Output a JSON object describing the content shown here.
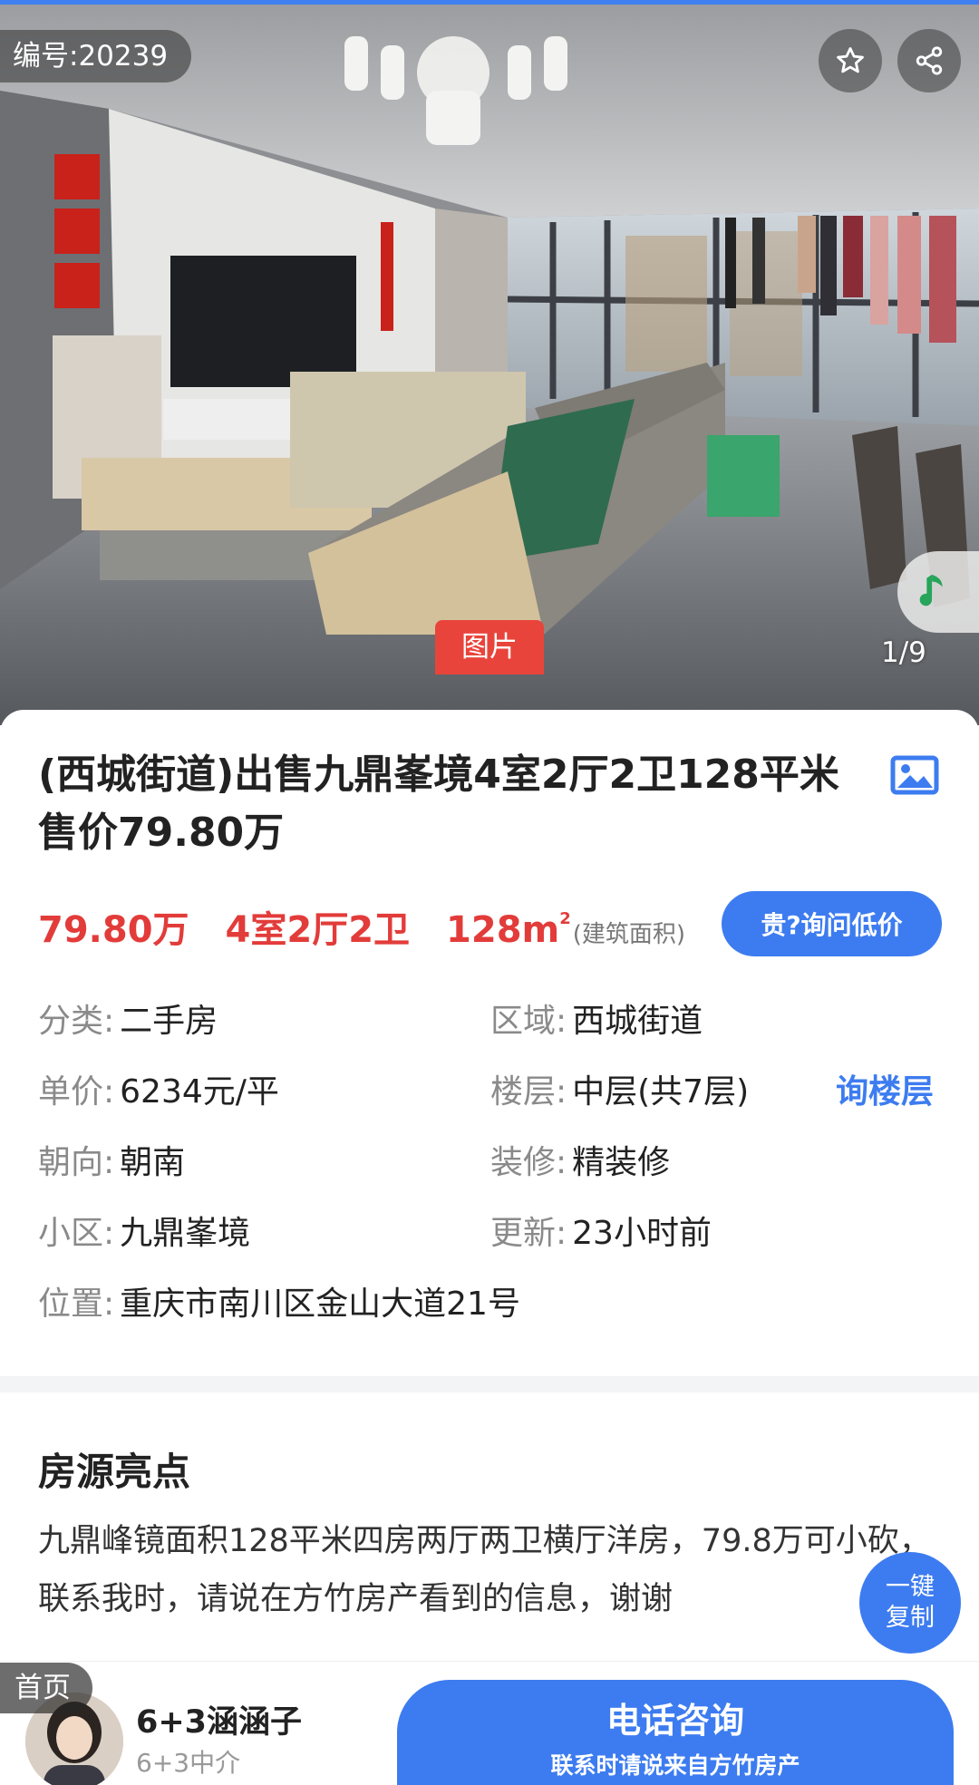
{
  "hero": {
    "code_label": "编号:20239",
    "photo_tag": "图片",
    "counter": "1/9",
    "icons": [
      "star-icon",
      "share-icon",
      "music-note-icon"
    ]
  },
  "listing": {
    "title": "(西城街道)出售九鼎峯境4室2厅2卫128平米 售价79.80万",
    "price": "79.80万",
    "rooms": "4室2厅2卫",
    "area": "128m",
    "area_sup": "2",
    "area_note": "(建筑面积)",
    "ask_button": "贵?询问低价",
    "floor_link": "询楼层",
    "info": {
      "category_key": "分类:",
      "category_val": "二手房",
      "district_key": "区域:",
      "district_val": "西城街道",
      "unit_price_key": "单价:",
      "unit_price_val": "6234元/平",
      "floor_key": "楼层:",
      "floor_val": "中层(共7层)",
      "orientation_key": "朝向:",
      "orientation_val": "朝南",
      "decor_key": "装修:",
      "decor_val": "精装修",
      "community_key": "小区:",
      "community_val": "九鼎峯境",
      "updated_key": "更新:",
      "updated_val": "23小时前",
      "location_key": "位置:",
      "location_val": "重庆市南川区金山大道21号"
    }
  },
  "highlights": {
    "title": "房源亮点",
    "text": "九鼎峰镜面积128平米四房两厅两卫横厅洋房，79.8万可小砍，联系我时，请说在方竹房产看到的信息，谢谢",
    "copy_line1": "一键",
    "copy_line2": "复制"
  },
  "bottom": {
    "home_label": "首页",
    "agent_name": "6+3涵涵子",
    "agent_company": "6+3中介",
    "call_main": "电话咨询",
    "call_sub": "联系时请说来自方竹房产"
  },
  "colors": {
    "accent_blue": "#3d7cf0",
    "price_red": "#e23c3a",
    "tag_red": "#e9443b"
  }
}
